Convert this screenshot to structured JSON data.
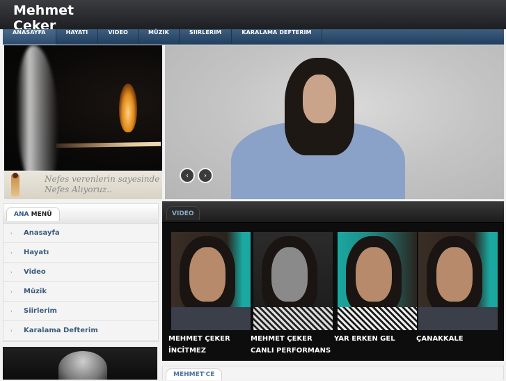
{
  "site": {
    "title": "Mehmet Çeker"
  },
  "nav": {
    "items": [
      {
        "label": "ANASAYFA"
      },
      {
        "label": "HAYATI"
      },
      {
        "label": "VIDEO"
      },
      {
        "label": "MÜZIK"
      },
      {
        "label": "SIIRLERIM"
      },
      {
        "label": "KARALAMA DEFTERIM"
      }
    ]
  },
  "slideshow": {
    "strip_text": "Nefes verenlerin sayesinde Nefes Alıyoruz..",
    "prev_icon": "‹",
    "next_icon": "›"
  },
  "menu": {
    "title_highlight": "ANA",
    "title_rest": "MENÜ",
    "arrow": "›",
    "items": [
      {
        "label": "Anasayfa"
      },
      {
        "label": "Hayatı"
      },
      {
        "label": "Video"
      },
      {
        "label": "Müzik"
      },
      {
        "label": "Siirlerim"
      },
      {
        "label": "Karalama Defterim"
      }
    ]
  },
  "video": {
    "title": "VIDEO",
    "items": [
      {
        "label": "MEHMET ÇEKER İNCİTMEZ"
      },
      {
        "label": "MEHMET ÇEKER CANLI PERFORMANS"
      },
      {
        "label": "YAR ERKEN GEL"
      },
      {
        "label": "ÇANAKKALE"
      }
    ]
  },
  "mehmetce": {
    "title": "MEHMET'CE"
  },
  "colors": {
    "nav_bg": "#2c4b6c",
    "accent_link": "#3c5c7e",
    "video_bg": "#0d0d0d",
    "thumb_teal": "#1aa8a0"
  }
}
